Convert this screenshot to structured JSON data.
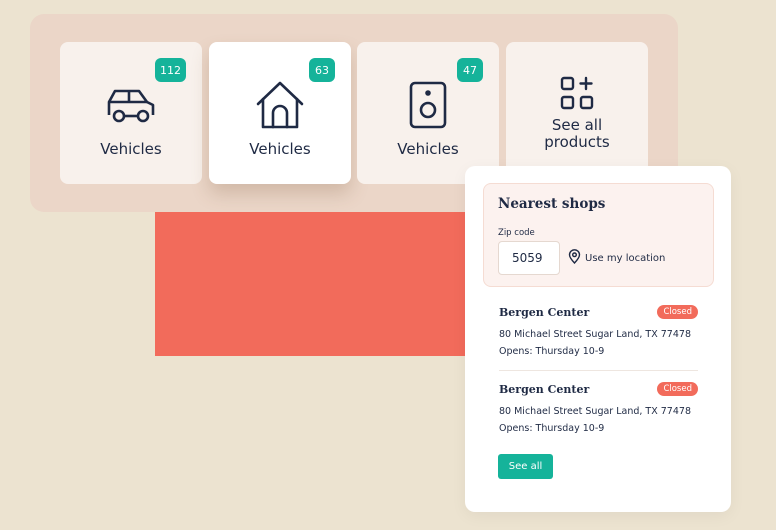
{
  "categories": [
    {
      "label": "Vehicles",
      "count": "112",
      "icon": "car-icon"
    },
    {
      "label": "Vehicles",
      "count": "63",
      "icon": "house-icon"
    },
    {
      "label": "Vehicles",
      "count": "47",
      "icon": "speaker-icon"
    }
  ],
  "see_all_products": {
    "line1": "See all",
    "line2": "products",
    "icon": "grid-add-icon"
  },
  "shops_widget": {
    "title": "Nearest shops",
    "zip_label": "Zip code",
    "zip_value": "5059",
    "use_location": "Use my location",
    "shops": [
      {
        "name": "Bergen Center",
        "status": "Closed",
        "address": "80 Michael Street Sugar Land, TX 77478",
        "opens": "Opens: Thursday 10-9"
      },
      {
        "name": "Bergen Center",
        "status": "Closed",
        "address": "80 Michael Street Sugar Land, TX 77478",
        "opens": "Opens: Thursday 10-9"
      }
    ],
    "see_all": "See all"
  },
  "colors": {
    "accent": "#15b39a",
    "coral": "#f26b5b",
    "panel": "#ebd6c8",
    "background": "#ece3d0",
    "text": "#1f2a44"
  }
}
